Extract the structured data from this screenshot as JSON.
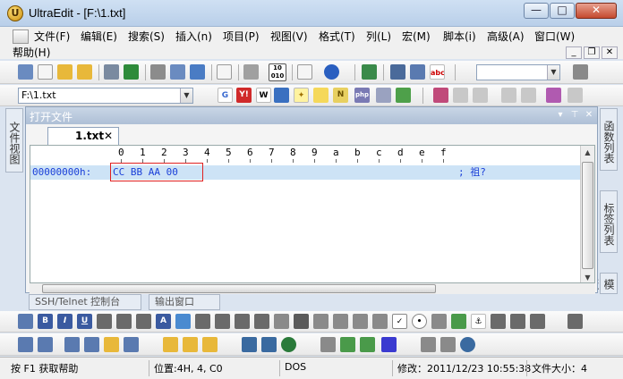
{
  "window": {
    "app_icon_glyph": "U",
    "title": "UltraEdit - [F:\\1.txt]",
    "minimize_glyph": "—",
    "maximize_glyph": "□",
    "close_glyph": "✕"
  },
  "menubar": {
    "items": [
      "文件(F)",
      "编辑(E)",
      "搜索(S)",
      "插入(n)",
      "项目(P)",
      "视图(V)",
      "格式(T)",
      "列(L)",
      "宏(M)",
      "脚本(i)",
      "高级(A)",
      "窗口(W)",
      "帮助(H)"
    ],
    "mdi_minimize": "_",
    "mdi_restore": "❐",
    "mdi_close": "✕"
  },
  "toolbar_main": {
    "icons": [
      "new-file-icon",
      "open-folder-icon",
      "open-icon",
      "save-icon",
      "close-file-icon",
      "print-icon",
      "print-preview-icon",
      "spellcheck-icon",
      "word-count-icon",
      "format-icon",
      "hex-toggle-icon",
      "file-icon",
      "globe-icon",
      "network-icon",
      "binoculars-icon",
      "find-replace-icon",
      "abc-spell-icon"
    ],
    "hex_label": "10 010"
  },
  "toolbar_file": {
    "file_combo": "F:\\1.txt",
    "search_icons": [
      "google-icon",
      "yahoo-icon",
      "wikipedia-icon",
      "tracker-icon",
      "idea-icon",
      "sticky-icon",
      "notes-icon",
      "php-icon",
      "link-icon",
      "windows-icon",
      "tag-icon",
      "redo-icon",
      "tool-icon",
      "tool2-icon",
      "marker-icon",
      "clear-icon"
    ]
  },
  "side_tabs": {
    "left": "文件视图",
    "right_1": "函数列表",
    "right_2": "标签列表",
    "right_3": "模板"
  },
  "panel": {
    "title": "打开文件",
    "menu_glyph": "▾",
    "pin_glyph": "⊤",
    "close_glyph": "✕",
    "doc_tab": "1.txt",
    "doc_tab_close": "✕"
  },
  "hex": {
    "ruler": [
      "0",
      "1",
      "2",
      "3",
      "4",
      "5",
      "6",
      "7",
      "8",
      "9",
      "a",
      "b",
      "c",
      "d",
      "e",
      "f"
    ],
    "address": "00000000h:",
    "bytes": "CC BB AA 00",
    "text": "; 祖?"
  },
  "bottom_tabs": {
    "ssh": "SSH/Telnet 控制台",
    "output": "输出窗口"
  },
  "statusbar": {
    "help": "按 F1 获取帮助",
    "position": "位置:4H, 4, C0",
    "line_ending": "DOS",
    "modified": "修改：2011/12/23 10:55:38",
    "file_size": "文件大小：4"
  },
  "colors": {
    "hex_text": "#1a3fd8",
    "current_line": "#cde3f6",
    "selection_box": "#e02020",
    "panel_header": "#b5c5da"
  }
}
